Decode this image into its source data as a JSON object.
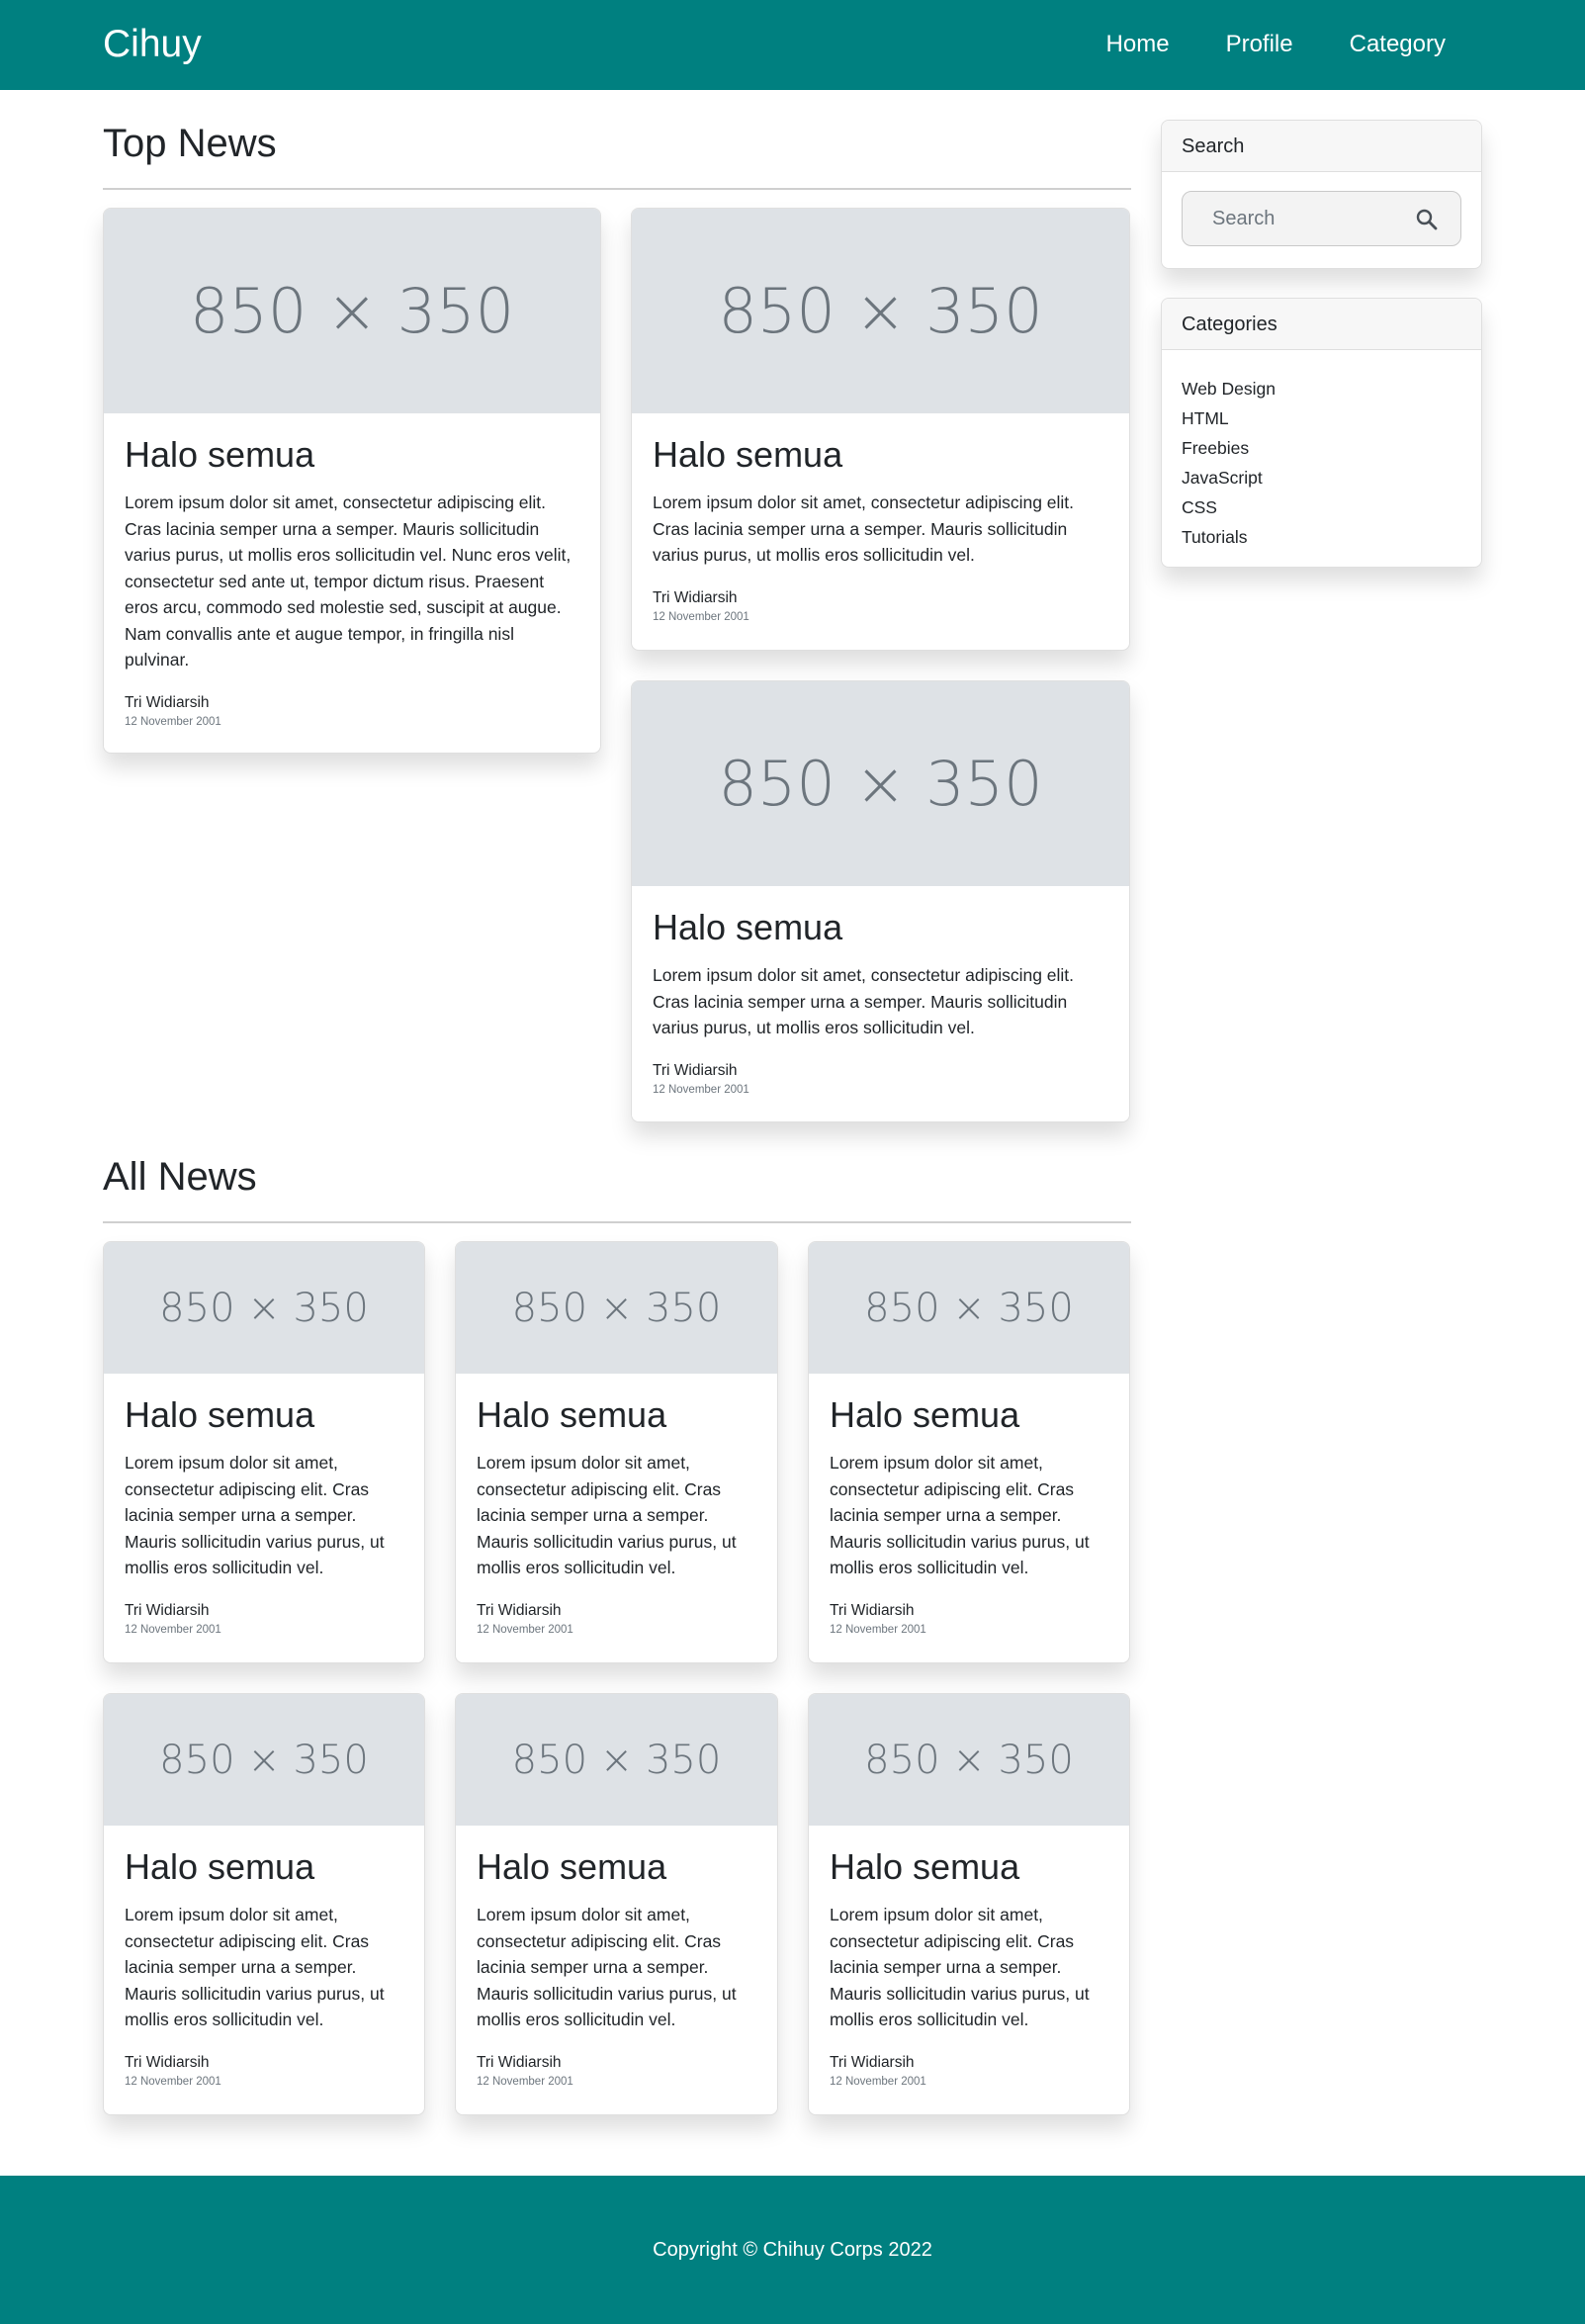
{
  "navbar": {
    "brand": "Cihuy",
    "links": [
      "Home",
      "Profile",
      "Category"
    ]
  },
  "top_news": {
    "title": "Top News",
    "cards": [
      {
        "image_label": "850 × 350",
        "title": "Halo semua",
        "text": "Lorem ipsum dolor sit amet, consectetur adipiscing elit. Cras lacinia semper urna a semper. Mauris sollicitudin varius purus, ut mollis eros sollicitudin vel. Nunc eros velit, consectetur sed ante ut, tempor dictum risus. Praesent eros arcu, commodo sed molestie sed, suscipit at augue. Nam convallis ante et augue tempor, in fringilla nisl pulvinar.",
        "author": "Tri Widiarsih",
        "date": "12 November 2001"
      },
      {
        "image_label": "850 × 350",
        "title": "Halo semua",
        "text": "Lorem ipsum dolor sit amet, consectetur adipiscing elit. Cras lacinia semper urna a semper. Mauris sollicitudin varius purus, ut mollis eros sollicitudin vel.",
        "author": "Tri Widiarsih",
        "date": "12 November 2001"
      },
      {
        "image_label": "850 × 350",
        "title": "Halo semua",
        "text": "Lorem ipsum dolor sit amet, consectetur adipiscing elit. Cras lacinia semper urna a semper. Mauris sollicitudin varius purus, ut mollis eros sollicitudin vel.",
        "author": "Tri Widiarsih",
        "date": "12 November 2001"
      }
    ]
  },
  "all_news": {
    "title": "All News",
    "cards": [
      {
        "image_label": "850 × 350",
        "title": "Halo semua",
        "text": "Lorem ipsum dolor sit amet, consectetur adipiscing elit. Cras lacinia semper urna a semper. Mauris sollicitudin varius purus, ut mollis eros sollicitudin vel.",
        "author": "Tri Widiarsih",
        "date": "12 November 2001"
      },
      {
        "image_label": "850 × 350",
        "title": "Halo semua",
        "text": "Lorem ipsum dolor sit amet, consectetur adipiscing elit. Cras lacinia semper urna a semper. Mauris sollicitudin varius purus, ut mollis eros sollicitudin vel.",
        "author": "Tri Widiarsih",
        "date": "12 November 2001"
      },
      {
        "image_label": "850 × 350",
        "title": "Halo semua",
        "text": "Lorem ipsum dolor sit amet, consectetur adipiscing elit. Cras lacinia semper urna a semper. Mauris sollicitudin varius purus, ut mollis eros sollicitudin vel.",
        "author": "Tri Widiarsih",
        "date": "12 November 2001"
      },
      {
        "image_label": "850 × 350",
        "title": "Halo semua",
        "text": "Lorem ipsum dolor sit amet, consectetur adipiscing elit. Cras lacinia semper urna a semper. Mauris sollicitudin varius purus, ut mollis eros sollicitudin vel.",
        "author": "Tri Widiarsih",
        "date": "12 November 2001"
      },
      {
        "image_label": "850 × 350",
        "title": "Halo semua",
        "text": "Lorem ipsum dolor sit amet, consectetur adipiscing elit. Cras lacinia semper urna a semper. Mauris sollicitudin varius purus, ut mollis eros sollicitudin vel.",
        "author": "Tri Widiarsih",
        "date": "12 November 2001"
      },
      {
        "image_label": "850 × 350",
        "title": "Halo semua",
        "text": "Lorem ipsum dolor sit amet, consectetur adipiscing elit. Cras lacinia semper urna a semper. Mauris sollicitudin varius purus, ut mollis eros sollicitudin vel.",
        "author": "Tri Widiarsih",
        "date": "12 November 2001"
      }
    ]
  },
  "sidebar": {
    "search": {
      "header": "Search",
      "placeholder": "Search",
      "icon": "search-icon"
    },
    "categories": {
      "header": "Categories",
      "items": [
        "Web Design",
        "HTML",
        "Freebies",
        "JavaScript",
        "CSS",
        "Tutorials"
      ]
    }
  },
  "footer": {
    "text": "Copyright © Chihuy Corps 2022"
  },
  "colors": {
    "brand": "#008080",
    "placeholder_bg": "#dee2e6",
    "placeholder_text": "#6c757d"
  }
}
